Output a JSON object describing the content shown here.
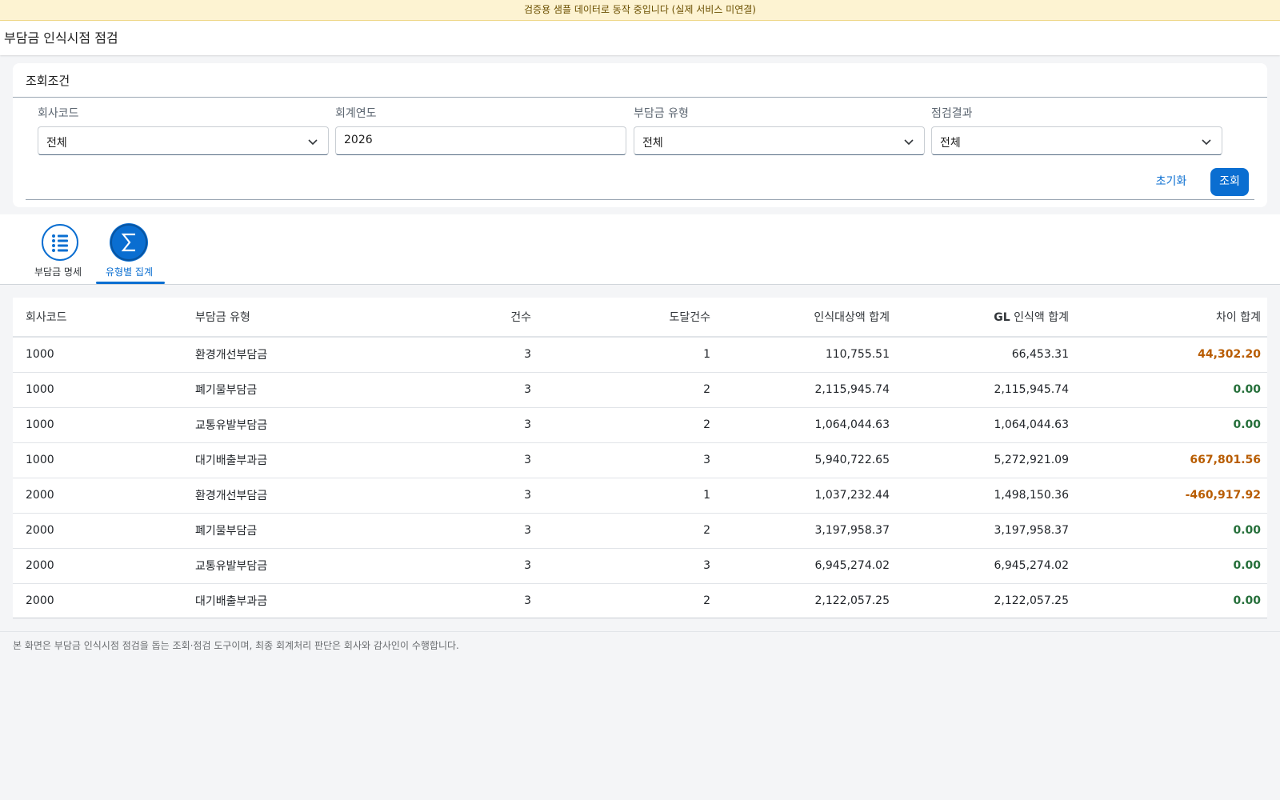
{
  "banner": "검증용 샘플 데이터로 동작 중입니다 (실제 서비스 미연결)",
  "page_title": "부담금 인식시점 점검",
  "filters": {
    "heading": "조회조건",
    "company_code": {
      "label": "회사코드",
      "value": "전체"
    },
    "fiscal_year": {
      "label": "회계연도",
      "value": "2026"
    },
    "charge_type": {
      "label": "부담금 유형",
      "value": "전체"
    },
    "check_result": {
      "label": "점검결과",
      "value": "전체"
    },
    "reset_label": "초기화",
    "search_label": "조회"
  },
  "tabs": [
    {
      "label": "부담금 명세",
      "icon": "list-icon",
      "selected": false
    },
    {
      "label": "유형별 집계",
      "icon": "sigma-icon",
      "selected": true
    }
  ],
  "table": {
    "headers": {
      "company": "회사코드",
      "type": "부담금 유형",
      "count": "건수",
      "reached": "도달건수",
      "target_sum": "인식대상액 합계",
      "gl_prefix": "GL",
      "gl_rest": " 인식액 합계",
      "diff_sum": "차이 합계"
    },
    "rows": [
      {
        "company": "1000",
        "type": "환경개선부담금",
        "count": "3",
        "reached": "1",
        "target": "110,755.51",
        "gl": "66,453.31",
        "diff": "44,302.20",
        "status": "pos"
      },
      {
        "company": "1000",
        "type": "폐기물부담금",
        "count": "3",
        "reached": "2",
        "target": "2,115,945.74",
        "gl": "2,115,945.74",
        "diff": "0.00",
        "status": "zero"
      },
      {
        "company": "1000",
        "type": "교통유발부담금",
        "count": "3",
        "reached": "2",
        "target": "1,064,044.63",
        "gl": "1,064,044.63",
        "diff": "0.00",
        "status": "zero"
      },
      {
        "company": "1000",
        "type": "대기배출부과금",
        "count": "3",
        "reached": "3",
        "target": "5,940,722.65",
        "gl": "5,272,921.09",
        "diff": "667,801.56",
        "status": "pos"
      },
      {
        "company": "2000",
        "type": "환경개선부담금",
        "count": "3",
        "reached": "1",
        "target": "1,037,232.44",
        "gl": "1,498,150.36",
        "diff": "-460,917.92",
        "status": "pos"
      },
      {
        "company": "2000",
        "type": "폐기물부담금",
        "count": "3",
        "reached": "2",
        "target": "3,197,958.37",
        "gl": "3,197,958.37",
        "diff": "0.00",
        "status": "zero"
      },
      {
        "company": "2000",
        "type": "교통유발부담금",
        "count": "3",
        "reached": "3",
        "target": "6,945,274.02",
        "gl": "6,945,274.02",
        "diff": "0.00",
        "status": "zero"
      },
      {
        "company": "2000",
        "type": "대기배출부과금",
        "count": "3",
        "reached": "2",
        "target": "2,122,057.25",
        "gl": "2,122,057.25",
        "diff": "0.00",
        "status": "zero"
      }
    ]
  },
  "footnote": "본 화면은 부담금 인식시점 점검을 돕는 조회·점검 도구이며, 최종 회계처리 판단은 회사와 감사인이 수행합니다.",
  "colors": {
    "accent": "#0a6ed1",
    "diff_nonzero": "#b85c00",
    "diff_zero": "#256f3a",
    "banner_bg": "#fdf3d2"
  }
}
